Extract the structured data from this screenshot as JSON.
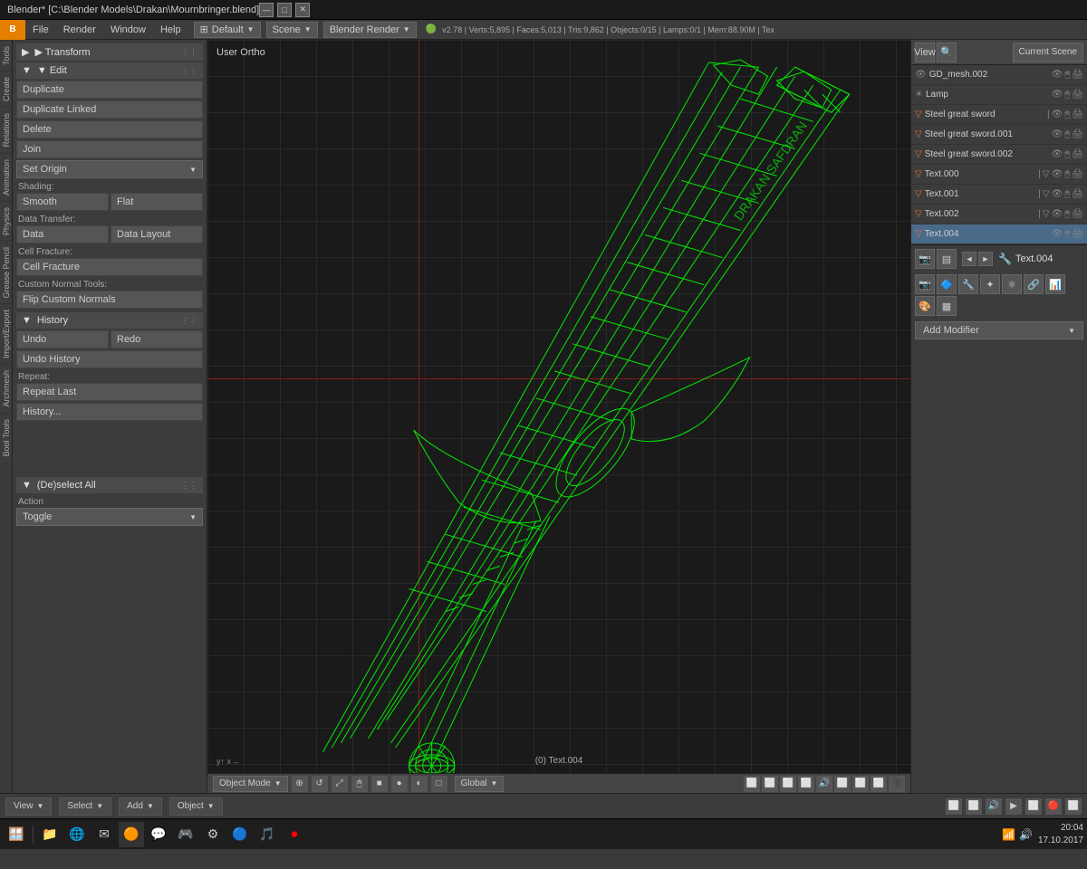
{
  "titleBar": {
    "title": "Blender* [C:\\Blender Models\\Drakan\\Mournbringer.blend]",
    "minimize": "—",
    "maximize": "□",
    "close": "✕"
  },
  "menuBar": {
    "logo": "B",
    "items": [
      "File",
      "Render",
      "Window",
      "Help"
    ]
  },
  "infoBar": {
    "layout_icon": "⊞",
    "layout_label": "Default",
    "scene_label": "Scene",
    "engine_label": "Blender Render",
    "stats": "v2.78 | Verts:5,895 | Faces:5,013 | Tris:9,862 | Objects:0/15 | Lamps:0/1 | Mem:88.90M | Tex"
  },
  "toolbar": {
    "edit_section": "▼ Edit",
    "transform_section": "▶ Transform",
    "duplicate_label": "Duplicate",
    "duplicate_linked_label": "Duplicate Linked",
    "delete_label": "Delete",
    "join_label": "Join",
    "set_origin_label": "Set Origin",
    "shading_label": "Shading:",
    "smooth_label": "Smooth",
    "flat_label": "Flat",
    "data_transfer_label": "Data Transfer:",
    "data_label": "Data",
    "data_layout_label": "Data Layout",
    "cell_fracture_label": "Cell Fracture:",
    "cell_fracture_btn": "Cell Fracture",
    "custom_normals_label": "Custom Normal Tools:",
    "flip_normals_label": "Flip Custom Normals",
    "history_section": "▼ History",
    "undo_label": "Undo",
    "redo_label": "Redo",
    "undo_history_label": "Undo History",
    "repeat_label": "Repeat:",
    "repeat_last_label": "Repeat Last",
    "history_dots_label": "History...",
    "deselect_section": "▼ (De)select All",
    "action_label": "Action",
    "toggle_label": "Toggle"
  },
  "leftTabs": [
    "Tools",
    "Create",
    "Relations",
    "Animation",
    "Physics",
    "Grease Pencil",
    "Import/Export",
    "Archmesh",
    "Bool Tools"
  ],
  "viewport": {
    "label": "User Ortho",
    "bottom_label": "(0) Text.004",
    "mode": "Object Mode",
    "transform": "Global"
  },
  "rightPanel": {
    "current_scene": "Current Scene",
    "view_btn": "View",
    "search_btn": "Search",
    "scene_items": [
      {
        "name": "GD_mesh.002",
        "indent": 0,
        "type": "mesh"
      },
      {
        "name": "Lamp",
        "indent": 0,
        "type": "lamp"
      },
      {
        "name": "Steel great sword",
        "indent": 0,
        "type": "curve"
      },
      {
        "name": "Steel great sword.001",
        "indent": 0,
        "type": "curve"
      },
      {
        "name": "Steel great sword.002",
        "indent": 0,
        "type": "curve"
      },
      {
        "name": "Text.000",
        "indent": 0,
        "type": "text"
      },
      {
        "name": "Text.001",
        "indent": 0,
        "type": "text"
      },
      {
        "name": "Text.002",
        "indent": 0,
        "type": "text"
      },
      {
        "name": "Text.004",
        "indent": 0,
        "type": "text",
        "active": true
      }
    ],
    "modifier_object": "Text.004",
    "add_modifier": "Add Modifier"
  },
  "statusBar": {
    "view_btn": "View",
    "select_btn": "Select",
    "add_btn": "Add",
    "object_btn": "Object"
  },
  "taskbar": {
    "time": "20:04",
    "date": "17.10.2017"
  }
}
